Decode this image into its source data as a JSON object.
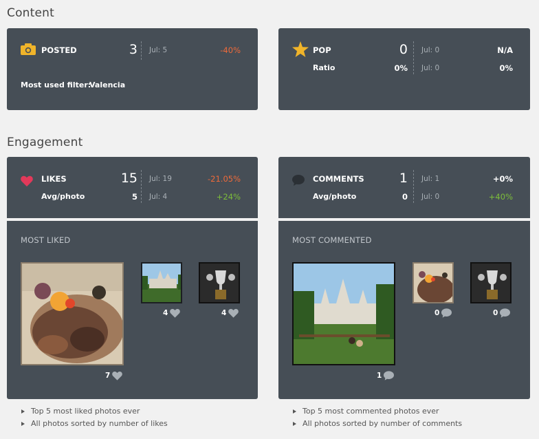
{
  "content": {
    "title": "Content",
    "posted": {
      "label": "POSTED",
      "value": "3",
      "date": "Jul: 5",
      "delta": "-40%"
    },
    "filter": {
      "label": "Most used filter:",
      "value": "Valencia"
    },
    "pop": {
      "label": "POP",
      "value": "0",
      "date": "Jul: 0",
      "delta": "N/A",
      "ratio_label": "Ratio",
      "ratio_value": "0%",
      "ratio_date": "Jul: 0",
      "ratio_delta": "0%"
    }
  },
  "engagement": {
    "title": "Engagement",
    "likes": {
      "label": "LIKES",
      "value": "15",
      "date": "Jul: 19",
      "delta": "-21.05%",
      "avg_label": "Avg/photo",
      "avg_value": "5",
      "avg_date": "Jul: 4",
      "avg_delta": "+24%"
    },
    "comments": {
      "label": "COMMENTS",
      "value": "1",
      "date": "Jul: 1",
      "delta": "+0%",
      "avg_label": "Avg/photo",
      "avg_value": "0",
      "avg_date": "Jul: 0",
      "avg_delta": "+40%"
    }
  },
  "most_liked": {
    "title": "MOST LIKED",
    "photos": [
      {
        "count": "7"
      },
      {
        "count": "4"
      },
      {
        "count": "4"
      }
    ],
    "links": [
      "Top 5 most liked photos ever",
      "All photos sorted by number of likes"
    ]
  },
  "most_commented": {
    "title": "MOST COMMENTED",
    "photos": [
      {
        "count": "1"
      },
      {
        "count": "0"
      },
      {
        "count": "0"
      }
    ],
    "links": [
      "Top 5 most commented photos ever",
      "All photos sorted by number of comments"
    ]
  },
  "colors": {
    "negative": "#ef6a3a",
    "positive": "#7dbe3a",
    "neutral": "#ffffff",
    "camera": "#f0b42a",
    "star": "#f0b42a",
    "heart": "#e2395a",
    "bubble": "#2b3035"
  }
}
